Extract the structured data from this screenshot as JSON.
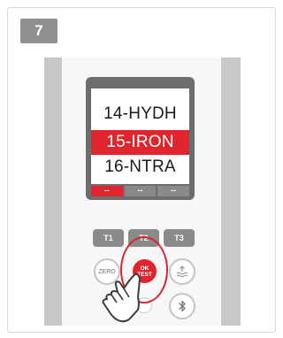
{
  "step": {
    "number": "7"
  },
  "display": {
    "menu": [
      "14-HYDH",
      "15-IRON",
      "16-NTRA"
    ],
    "selected_index": 1,
    "softkeys": [
      "--",
      "--",
      "--"
    ]
  },
  "buttons": {
    "t1": "T1",
    "t2": "T2",
    "t3": "T3",
    "zero": "ZERO",
    "ok_line1": "OK",
    "ok_line2": "TEST"
  },
  "colors": {
    "accent": "#e1252e",
    "gray": "#8a8a8a",
    "badge": "#8f8f8f"
  },
  "icons": {
    "water_level": "water-level-icon",
    "bluetooth": "bluetooth-icon",
    "hand": "hand-pointer-icon"
  }
}
